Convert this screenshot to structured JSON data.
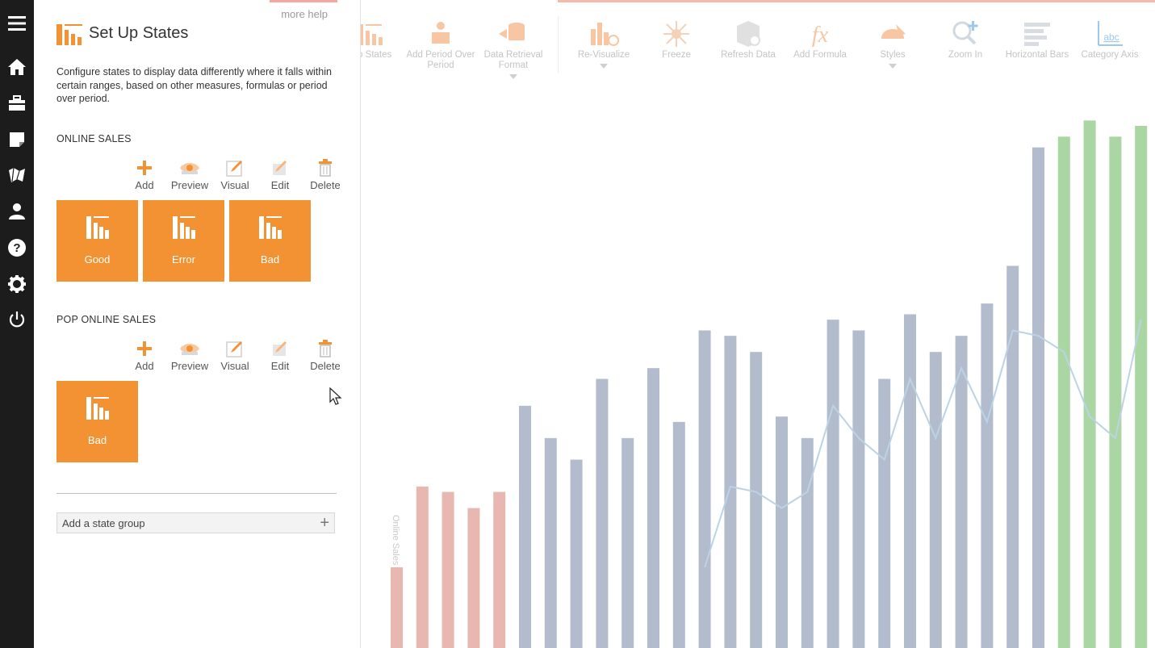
{
  "panel": {
    "more_help": "more help",
    "title": "Set Up States",
    "description": "Configure states to display data differently where it falls within certain ranges, based on other measures, formulas or period over period.",
    "groups": [
      {
        "label": "ONLINE SALES",
        "toolbar": [
          "Add",
          "Preview",
          "Visual",
          "Edit",
          "Delete"
        ],
        "states": [
          "Good",
          "Error",
          "Bad"
        ]
      },
      {
        "label": "POP ONLINE SALES",
        "toolbar": [
          "Add",
          "Preview",
          "Visual",
          "Edit",
          "Delete"
        ],
        "states": [
          "Bad"
        ]
      }
    ],
    "add_group": "Add a state group"
  },
  "ribbon": {
    "items": [
      {
        "label": "Up States",
        "dropdown": false
      },
      {
        "label": "Add Period Over Period",
        "dropdown": false
      },
      {
        "label": "Data Retrieval Format",
        "dropdown": true
      },
      {
        "label": "Re-Visualize",
        "dropdown": true
      },
      {
        "label": "Freeze",
        "dropdown": false
      },
      {
        "label": "Refresh Data",
        "dropdown": false
      },
      {
        "label": "Add Formula",
        "dropdown": false
      },
      {
        "label": "Styles",
        "dropdown": true
      },
      {
        "label": "Zoom In",
        "dropdown": false
      },
      {
        "label": "Horizontal Bars",
        "dropdown": false
      },
      {
        "label": "Category Axis",
        "dropdown": false
      }
    ]
  },
  "colors": {
    "accent": "#f39233",
    "bar_bad": "#e8b8b0",
    "bar_normal": "#b3bccd",
    "bar_good": "#a9d6a2",
    "line": "#bcd3e6"
  },
  "chart_data": {
    "type": "bar",
    "ylabel": "Online Sales",
    "ylim": [
      0,
      100
    ],
    "series": [
      {
        "values": [
          15,
          30,
          29,
          26,
          29,
          45,
          39,
          35,
          50,
          39,
          52,
          42,
          59,
          58,
          55,
          43,
          39,
          61,
          59,
          50,
          62,
          55,
          58,
          64,
          71,
          93,
          95,
          98,
          95,
          97
        ],
        "states": [
          "bad",
          "bad",
          "bad",
          "bad",
          "bad",
          "normal",
          "normal",
          "normal",
          "normal",
          "normal",
          "normal",
          "normal",
          "normal",
          "normal",
          "normal",
          "normal",
          "normal",
          "normal",
          "normal",
          "normal",
          "normal",
          "normal",
          "normal",
          "normal",
          "normal",
          "normal",
          "good",
          "good",
          "good",
          "good"
        ]
      },
      {
        "values": [
          null,
          null,
          null,
          null,
          null,
          null,
          null,
          null,
          null,
          null,
          null,
          null,
          15,
          30,
          29,
          26,
          29,
          45,
          39,
          35,
          50,
          39,
          52,
          42,
          59,
          58,
          55,
          43,
          39,
          61
        ]
      }
    ]
  }
}
